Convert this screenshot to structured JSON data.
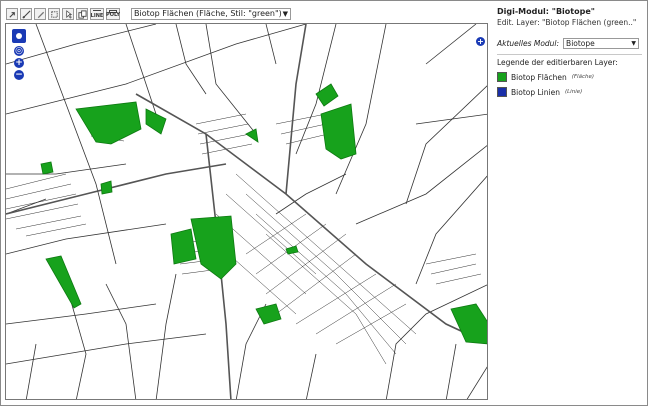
{
  "toolbar": {
    "buttons": [
      {
        "icon": "select-arrow-icon"
      },
      {
        "icon": "edit-line-icon"
      },
      {
        "icon": "edit-pencil-icon"
      },
      {
        "icon": "move-vertex-icon"
      },
      {
        "icon": "pointer-icon"
      },
      {
        "icon": "copy-icon"
      },
      {
        "icon": "line-tool-icon",
        "label": "LINE"
      },
      {
        "icon": "polygon-tool-icon",
        "label": "POLY"
      }
    ],
    "layer_select": {
      "value": "Biotop Flächen  (Fläche, Stil: \"green\")"
    }
  },
  "map": {
    "zoom_in": "+",
    "zoom_out": "−",
    "colors": {
      "biotope_fill": "#17a21c",
      "road": "#555555",
      "parcel": "#333333"
    }
  },
  "panel": {
    "title": "Digi-Modul: \"Biotope\"",
    "edit_layer": "Edit. Layer: \"Biotop Flächen (green..\"",
    "module_label": "Aktuelles Modul:",
    "module_value": "Biotope",
    "legend_title": "Legende der editierbaren Layer:",
    "legend": [
      {
        "name": "Biotop Flächen",
        "type": "(Fläche)",
        "color": "#17a21c"
      },
      {
        "name": "Biotop Linien",
        "type": "(Linie)",
        "color": "#1a2fa8"
      }
    ]
  }
}
